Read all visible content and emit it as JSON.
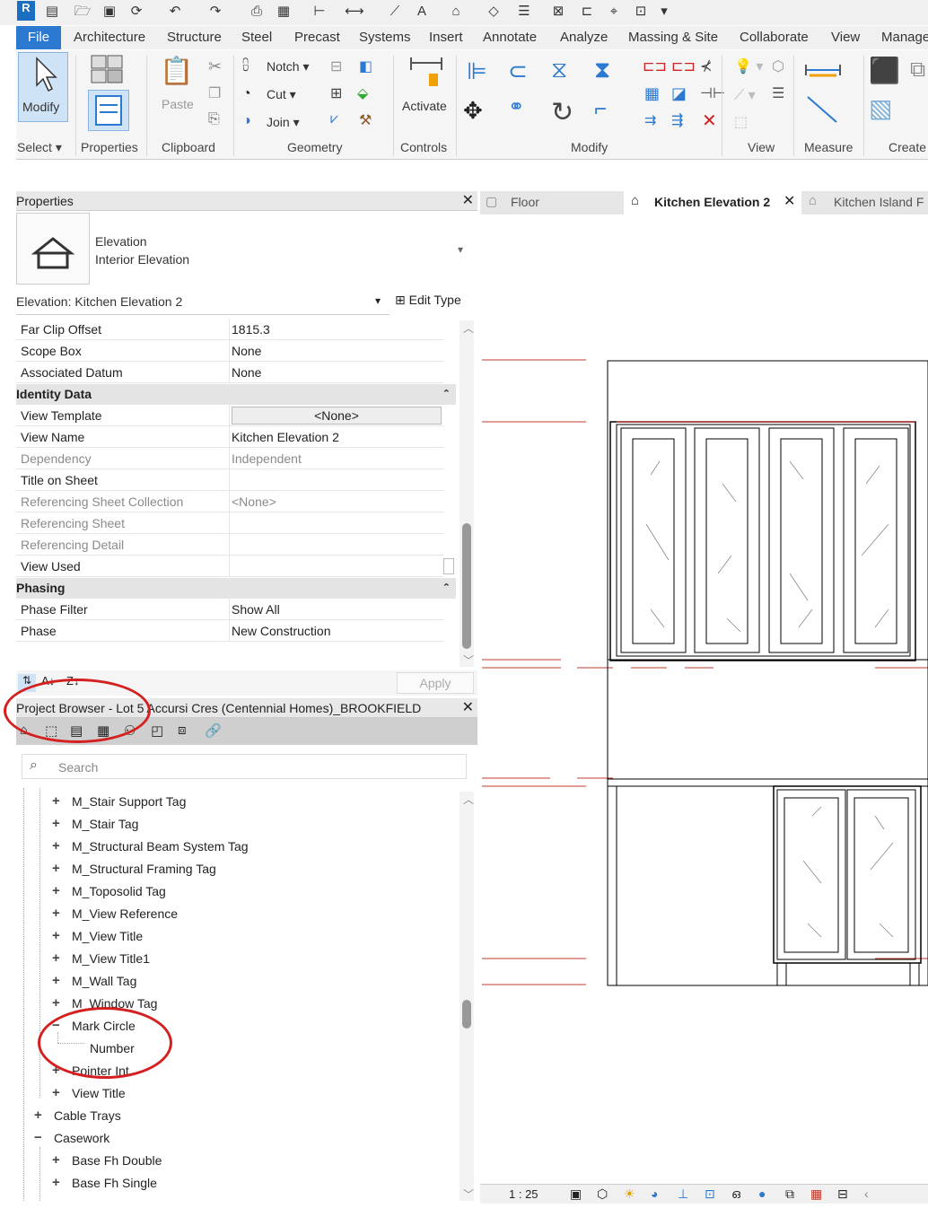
{
  "qat": {
    "logo": "R"
  },
  "ribbon_tabs": [
    "File",
    "Architecture",
    "Structure",
    "Steel",
    "Precast",
    "Systems",
    "Insert",
    "Annotate",
    "Analyze",
    "Massing & Site",
    "Collaborate",
    "View",
    "Manage"
  ],
  "ribbon": {
    "modify": "Modify",
    "select": "Select",
    "properties": "Properties",
    "paste": "Paste",
    "clipboard": "Clipboard",
    "notch": "Notch",
    "cut": "Cut",
    "join": "Join",
    "geometry": "Geometry",
    "activate": "Activate",
    "controls": "Controls",
    "modify_group": "Modify",
    "view_group": "View",
    "measure_group": "Measure",
    "create_group": "Create"
  },
  "properties": {
    "title": "Properties",
    "type_line1": "Elevation",
    "type_line2": "Interior Elevation",
    "instance": "Elevation: Kitchen Elevation 2",
    "edit_type": "Edit Type",
    "apply": "Apply",
    "rows_top": [
      {
        "k": "Far Clip Offset",
        "v": "1815.3"
      },
      {
        "k": "Scope Box",
        "v": "None"
      },
      {
        "k": "Associated Datum",
        "v": "None"
      }
    ],
    "section_identity": "Identity Data",
    "identity_rows": [
      {
        "k": "View Template",
        "v": "<None>"
      },
      {
        "k": "View Name",
        "v": "Kitchen Elevation 2"
      },
      {
        "k": "Dependency",
        "v": "Independent"
      },
      {
        "k": "Title on Sheet",
        "v": ""
      },
      {
        "k": "Referencing Sheet Collection",
        "v": "<None>"
      },
      {
        "k": "Referencing Sheet",
        "v": ""
      },
      {
        "k": "Referencing Detail",
        "v": ""
      },
      {
        "k": "View Used",
        "v": ""
      }
    ],
    "section_phasing": "Phasing",
    "phasing_rows": [
      {
        "k": "Phase Filter",
        "v": "Show All"
      },
      {
        "k": "Phase",
        "v": "New Construction"
      }
    ]
  },
  "browser": {
    "title": "Project Browser - Lot 5 Accursi Cres (Centennial Homes)_BROOKFIELD",
    "search_placeholder": "Search",
    "items": [
      "M_Stair Support Tag",
      "M_Stair Tag",
      "M_Structural Beam System Tag",
      "M_Structural Framing Tag",
      "M_Toposolid Tag",
      "M_View Reference",
      "M_View Title",
      "M_View Title1",
      "M_Wall Tag",
      "M_Window Tag",
      "Mark Circle",
      "Number",
      "Pointer Int",
      "View Title",
      "Cable Trays",
      "Casework",
      "Base Fh Double",
      "Base Fh Single"
    ]
  },
  "views": {
    "tab_floor": "Floor",
    "tab_active": "Kitchen Elevation 2",
    "tab_island": "Kitchen Island F",
    "scale": "1 : 25"
  },
  "colors": {
    "accent": "#2b79d0",
    "annotation": "#d42020",
    "datum": "#c0392b"
  }
}
